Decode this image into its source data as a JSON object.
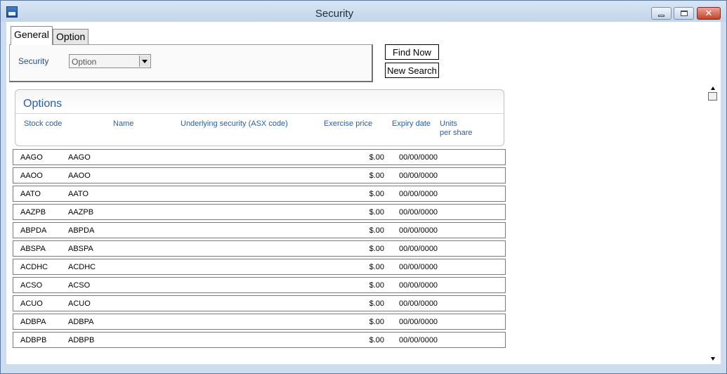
{
  "window": {
    "title": "Security"
  },
  "tabs": [
    {
      "label": "General"
    },
    {
      "label": "Option"
    }
  ],
  "form": {
    "security_label": "Security",
    "security_value": "Option"
  },
  "buttons": {
    "find_now": "Find Now",
    "new_search": "New Search"
  },
  "options": {
    "title": "Options",
    "columns": [
      "Stock code",
      "Name",
      "Underlying security (ASX code)",
      "Exercise price",
      "Expiry date",
      "Units\nper share"
    ],
    "rows": [
      {
        "stock_code": "AAGO",
        "name": "AAGO",
        "exercise_price": "$.00",
        "expiry_date": "00/00/0000"
      },
      {
        "stock_code": "AAOO",
        "name": "AAOO",
        "exercise_price": "$.00",
        "expiry_date": "00/00/0000"
      },
      {
        "stock_code": "AATO",
        "name": "AATO",
        "exercise_price": "$.00",
        "expiry_date": "00/00/0000"
      },
      {
        "stock_code": "AAZPB",
        "name": "AAZPB",
        "exercise_price": "$.00",
        "expiry_date": "00/00/0000"
      },
      {
        "stock_code": "ABPDA",
        "name": "ABPDA",
        "exercise_price": "$.00",
        "expiry_date": "00/00/0000"
      },
      {
        "stock_code": "ABSPA",
        "name": "ABSPA",
        "exercise_price": "$.00",
        "expiry_date": "00/00/0000"
      },
      {
        "stock_code": "ACDHC",
        "name": "ACDHC",
        "exercise_price": "$.00",
        "expiry_date": "00/00/0000"
      },
      {
        "stock_code": "ACSO",
        "name": "ACSO",
        "exercise_price": "$.00",
        "expiry_date": "00/00/0000"
      },
      {
        "stock_code": "ACUO",
        "name": "ACUO",
        "exercise_price": "$.00",
        "expiry_date": "00/00/0000"
      },
      {
        "stock_code": "ADBPA",
        "name": "ADBPA",
        "exercise_price": "$.00",
        "expiry_date": "00/00/0000"
      },
      {
        "stock_code": "ADBPB",
        "name": "ADBPB",
        "exercise_price": "$.00",
        "expiry_date": "00/00/0000"
      }
    ]
  },
  "icons": {
    "app": "app-icon",
    "minimize": "minimize-icon",
    "maximize": "maximize-icon",
    "close": "close-icon",
    "dropdown": "chevron-down-icon",
    "scroll_up": "scroll-up-icon",
    "scroll_down": "scroll-down-icon"
  }
}
